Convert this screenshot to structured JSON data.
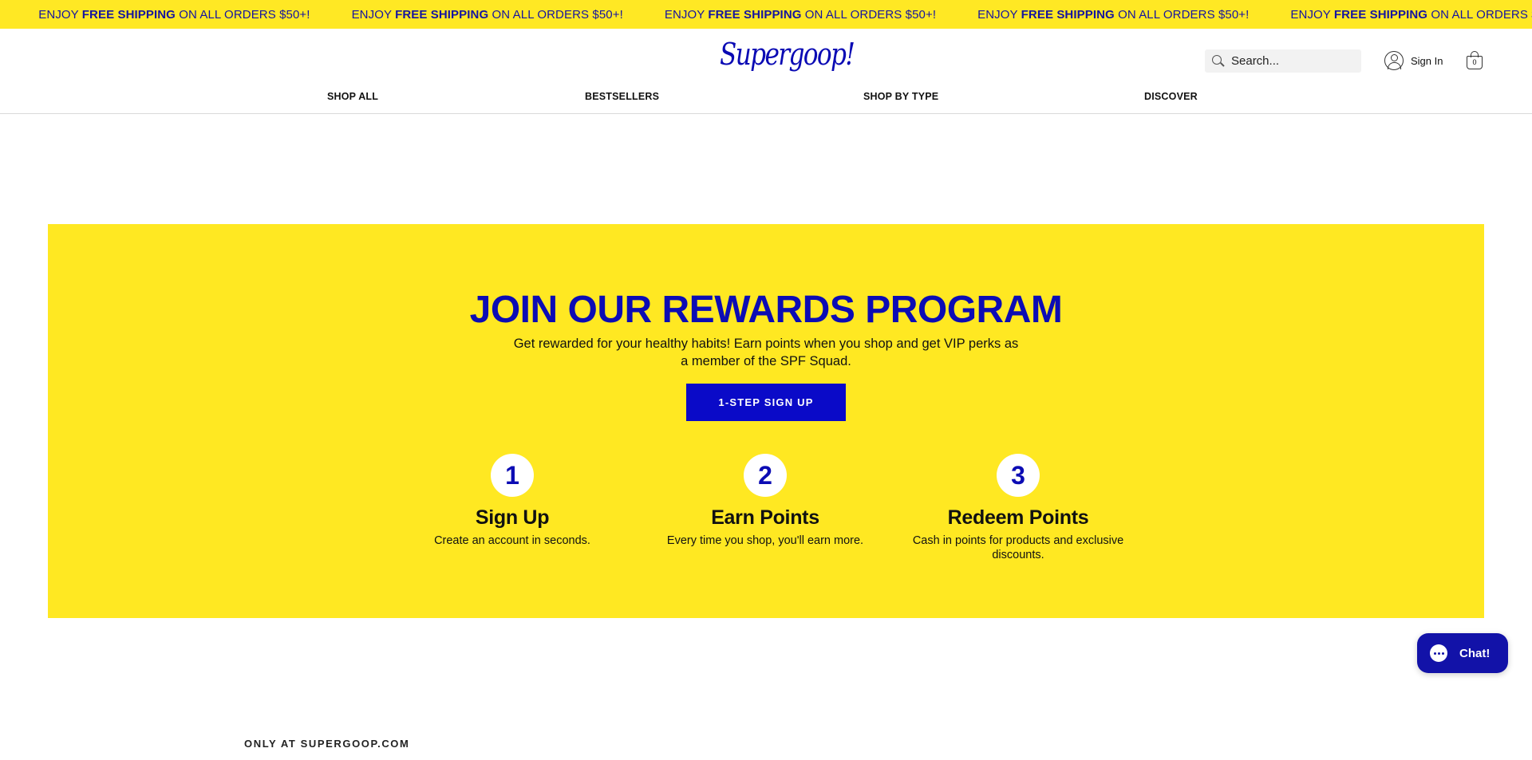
{
  "announcement": {
    "prefix": "ENJOY ",
    "highlight": "FREE SHIPPING",
    "suffix": " ON ALL ORDERS $50+!",
    "repeat_count": 7
  },
  "header": {
    "logo_text": "Supergoop!",
    "search_placeholder": "Search...",
    "signin_label": "Sign In",
    "cart_count": "0",
    "nav": [
      {
        "label": "SHOP ALL"
      },
      {
        "label": "BESTSELLERS"
      },
      {
        "label": "SHOP BY TYPE"
      },
      {
        "label": "DISCOVER"
      }
    ]
  },
  "rewards": {
    "title": "JOIN OUR REWARDS PROGRAM",
    "subtitle": "Get rewarded for your healthy habits! Earn points when you shop and get VIP perks as a member of the SPF Squad.",
    "button_label": "1-STEP SIGN UP",
    "steps": [
      {
        "number": "1",
        "title": "Sign Up",
        "desc": "Create an account in seconds."
      },
      {
        "number": "2",
        "title": "Earn Points",
        "desc": "Every time you shop, you'll earn more."
      },
      {
        "number": "3",
        "title": "Redeem Points",
        "desc": "Cash in points for products and exclusive discounts."
      }
    ]
  },
  "chat": {
    "label": "Chat!"
  },
  "section_label": "ONLY AT SUPERGOOP.COM",
  "colors": {
    "brand_yellow": "#ffe822",
    "brand_blue": "#0c0cb4"
  },
  "icons": [
    "search-icon",
    "user-icon",
    "cart-icon",
    "chat-icon"
  ]
}
